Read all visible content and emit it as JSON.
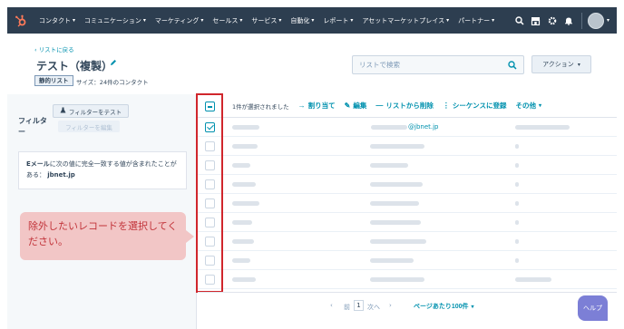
{
  "nav": {
    "items": [
      "コンタクト",
      "コミュニケーション",
      "マーケティング",
      "セールス",
      "サービス",
      "自動化",
      "レポート",
      "アセットマーケットプレイス",
      "パートナー"
    ],
    "icons": [
      "search-icon",
      "marketplace-icon",
      "gear-icon",
      "bell-icon"
    ]
  },
  "header": {
    "back_link": "‹ リストに戻る",
    "title": "テスト（複製）",
    "badge": "静的リスト",
    "size": "サイズ：24件のコンタクト",
    "search_placeholder": "リストで検索",
    "action_label": "アクション"
  },
  "filters": {
    "title": "フィルター",
    "test_button": "フィルターをテスト",
    "edit_button": "フィルターを編集",
    "condition_label": "Eメール",
    "condition_text": "に次の値に完全一致する値が含まれたことがある：",
    "condition_value": "jbnet.jp"
  },
  "callout": {
    "text": "除外したいレコードを選択してください。"
  },
  "toolbar": {
    "selected_count": "1件が選択されました",
    "assign": "割り当て",
    "edit": "編集",
    "remove": "リストから削除",
    "enroll": "シーケンスに登録",
    "more": "その他"
  },
  "table": {
    "rows": [
      {
        "checked": true,
        "email_suffix": "@jbnet.jp"
      },
      {
        "checked": false,
        "email_suffix": ""
      },
      {
        "checked": false,
        "email_suffix": ""
      },
      {
        "checked": false,
        "email_suffix": ""
      },
      {
        "checked": false,
        "email_suffix": ""
      },
      {
        "checked": false,
        "email_suffix": ""
      },
      {
        "checked": false,
        "email_suffix": ""
      },
      {
        "checked": false,
        "email_suffix": ""
      },
      {
        "checked": false,
        "email_suffix": ""
      }
    ]
  },
  "pager": {
    "prev": "前",
    "current": "1",
    "next": "次へ",
    "per_page": "ページあたり100件"
  },
  "help": "ヘルプ",
  "colors": {
    "nav_bg": "#2d3e50",
    "accent": "#0091ae",
    "highlight": "#d0262c",
    "callout_bg": "#f2c6c6",
    "callout_text": "#c2343a",
    "help_bg": "#7c7fd6",
    "logo": "#ff7a59"
  }
}
